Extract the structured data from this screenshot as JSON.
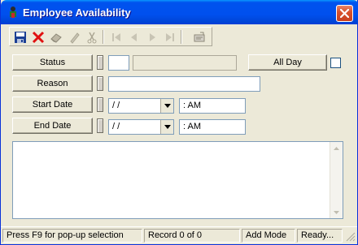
{
  "window": {
    "title": "Employee Availability"
  },
  "toolbar": {
    "buttons": [
      {
        "name": "save",
        "icon": "floppy-disk-icon"
      },
      {
        "name": "delete",
        "icon": "red-x-icon"
      },
      {
        "name": "eraser",
        "icon": "eraser-icon"
      },
      {
        "name": "edit",
        "icon": "pencil-icon"
      },
      {
        "name": "cut",
        "icon": "scissors-icon"
      },
      {
        "name": "first",
        "icon": "first-record-icon"
      },
      {
        "name": "previous",
        "icon": "previous-record-icon"
      },
      {
        "name": "next",
        "icon": "next-record-icon"
      },
      {
        "name": "last",
        "icon": "last-record-icon"
      },
      {
        "name": "lookup",
        "icon": "lookup-icon"
      }
    ]
  },
  "form": {
    "status_label": "Status",
    "status_code": "",
    "status_description": "",
    "all_day_label": "All Day",
    "all_day_checked": false,
    "reason_label": "Reason",
    "reason_value": "",
    "start_date_label": "Start Date",
    "start_date_value": " / /",
    "start_time_value": "  :  AM",
    "end_date_label": "End Date",
    "end_date_value": " / /",
    "end_time_value": "  :  AM",
    "notes_value": ""
  },
  "status_bar": {
    "hint": "Press F9 for pop-up selection",
    "record": "Record 0 of 0",
    "mode": "Add Mode",
    "state": "Ready..."
  },
  "colors": {
    "titlebar": "#0053ee",
    "close_button": "#d9522c",
    "window_face": "#ece9d8",
    "field_border": "#7f9db9"
  }
}
